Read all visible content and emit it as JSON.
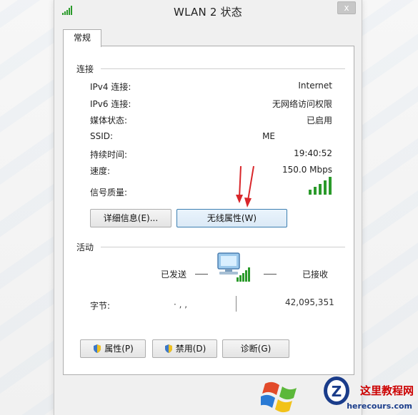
{
  "window": {
    "title": "WLAN 2 状态",
    "close_label": "x"
  },
  "tabs": [
    {
      "label": "常规"
    }
  ],
  "connection": {
    "group_title": "连接",
    "rows": [
      {
        "label": "IPv4 连接:",
        "value": "Internet"
      },
      {
        "label": "IPv6 连接:",
        "value": "无网络访问权限"
      },
      {
        "label": "媒体状态:",
        "value": "已启用"
      },
      {
        "label": "SSID:",
        "value": "ME"
      },
      {
        "label": "持续时间:",
        "value": "19:40:52"
      },
      {
        "label": "速度:",
        "value": "150.0 Mbps"
      },
      {
        "label": "信号质量:",
        "value": ""
      }
    ],
    "signal_bars": 5,
    "details_button": "详细信息(E)...",
    "wireless_button": "无线属性(W)"
  },
  "activity": {
    "group_title": "活动",
    "sent_label": "已发送",
    "received_label": "已接收",
    "bytes_label": "字节:",
    "bytes_sent": "· ,  ,",
    "bytes_received": "42,095,351"
  },
  "footer_buttons": {
    "properties": "属性(P)",
    "disable": "禁用(D)",
    "diagnose": "诊断(G)"
  },
  "watermark": {
    "site_name": "这里教程网",
    "site_url": "herecours.com"
  },
  "colors": {
    "accent_border": "#3c7fb1",
    "arrow_red": "#d9262a",
    "signal_green": "#2a9a2a"
  }
}
